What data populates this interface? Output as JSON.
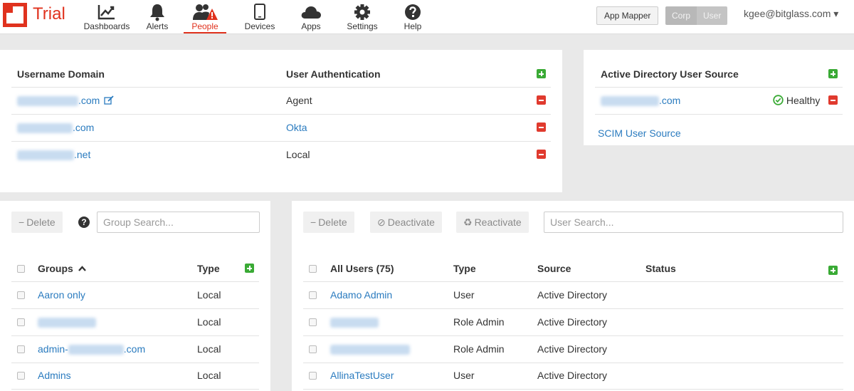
{
  "app": {
    "logo_text": "Trial",
    "brand_color": "#e0321e"
  },
  "nav": {
    "dashboards": "Dashboards",
    "alerts": "Alerts",
    "people": "People",
    "devices": "Devices",
    "apps": "Apps",
    "settings": "Settings",
    "help": "Help"
  },
  "header": {
    "app_mapper": "App Mapper",
    "toggle_corp": "Corp",
    "toggle_user": "User",
    "user_email": "kgee@bitglass.com ▾"
  },
  "domains_panel": {
    "col_domain": "Username Domain",
    "col_auth": "User Authentication",
    "rows": [
      {
        "domain_suffix": ".com",
        "auth": "Agent",
        "auth_is_link": false
      },
      {
        "domain_suffix": ".com",
        "auth": "Okta",
        "auth_is_link": true
      },
      {
        "domain_suffix": ".net",
        "auth": "Local",
        "auth_is_link": false
      }
    ]
  },
  "ad_panel": {
    "title": "Active Directory User Source",
    "source_suffix": ".com",
    "status": "Healthy",
    "scim_link": "SCIM User Source"
  },
  "groups_panel": {
    "delete_label": "Delete",
    "search_placeholder": "Group Search...",
    "col_groups": "Groups",
    "sort_icon": "chevron-up-icon",
    "col_type": "Type",
    "rows": [
      {
        "name": "Aaron only",
        "type": "Local"
      },
      {
        "name": "",
        "type": "Local"
      },
      {
        "name_prefix": "admin-",
        "name_suffix": ".com",
        "type": "Local"
      },
      {
        "name": "Admins",
        "type": "Local"
      }
    ]
  },
  "users_panel": {
    "delete_label": "Delete",
    "deactivate_label": "Deactivate",
    "reactivate_label": "Reactivate",
    "search_placeholder": "User Search...",
    "col_users": "All Users (75)",
    "col_type": "Type",
    "col_source": "Source",
    "col_status": "Status",
    "rows": [
      {
        "name": "Adamo Admin",
        "type": "User",
        "source": "Active Directory"
      },
      {
        "name": "",
        "type": "Role Admin",
        "source": "Active Directory"
      },
      {
        "name": "",
        "type": "Role Admin",
        "source": "Active Directory"
      },
      {
        "name": "AllinaTestUser",
        "type": "User",
        "source": "Active Directory"
      }
    ]
  }
}
